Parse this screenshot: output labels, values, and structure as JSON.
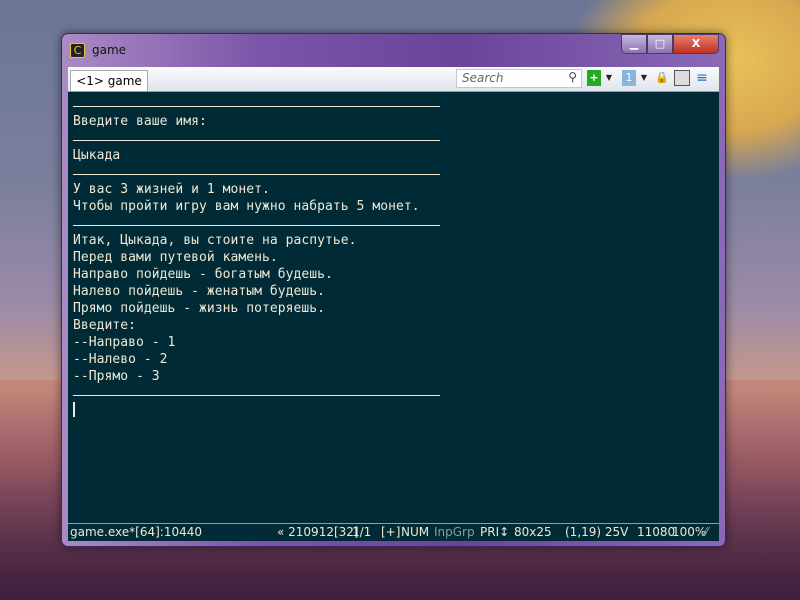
{
  "window": {
    "title": "game",
    "minimize": "▁",
    "maximize": "□",
    "close": "X",
    "app_icon": "conemu-icon"
  },
  "toolbar": {
    "tab_label": "<1> game",
    "search_placeholder": "Search"
  },
  "console": {
    "lines": [
      {
        "text": "Введите ваше имя:",
        "row": 1
      },
      {
        "text": "Цыкада",
        "row": 3
      },
      {
        "text": "У вас 3 жизней и 1 монет.",
        "row": 5
      },
      {
        "text": "Чтобы пройти игру вам нужно набрать 5 монет.",
        "row": 6
      },
      {
        "text": "Итак, Цыкада, вы стоите на распутье.",
        "row": 8
      },
      {
        "text": "Перед вами путевой камень.",
        "row": 9
      },
      {
        "text": "Направо пойдешь - богатым будешь.",
        "row": 10
      },
      {
        "text": "Налево пойдешь - женатым будешь.",
        "row": 11
      },
      {
        "text": "Прямо пойдешь - жизнь потеряешь.",
        "row": 12
      },
      {
        "text": "Введите:",
        "row": 13
      },
      {
        "text": "--Направо - 1",
        "row": 14
      },
      {
        "text": "--Налево - 2",
        "row": 15
      },
      {
        "text": "--Прямо - 3",
        "row": 16
      }
    ]
  },
  "status": {
    "process": "game.exe*[64]:10440",
    "buffer": "« 210912[32]",
    "console_index": "1/1",
    "plus": "[+]",
    "num": "NUM",
    "inpgrp": "InpGrp",
    "pri": "PRI↕",
    "size": "80x25",
    "cursor": "(1,19) 25V",
    "pid": "11080",
    "zoom": "100%"
  }
}
